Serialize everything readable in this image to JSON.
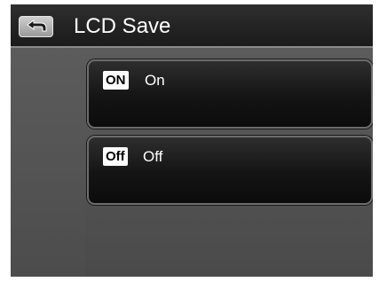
{
  "header": {
    "title": "LCD Save",
    "back_icon": "back-arrow-icon"
  },
  "menu": {
    "options": [
      {
        "badge": "ON",
        "label": "On"
      },
      {
        "badge": "Off",
        "label": "Off"
      }
    ]
  },
  "colors": {
    "title_bar": "#232323",
    "background": "#565656",
    "option_fill": "#141414",
    "text": "#ffffff"
  }
}
